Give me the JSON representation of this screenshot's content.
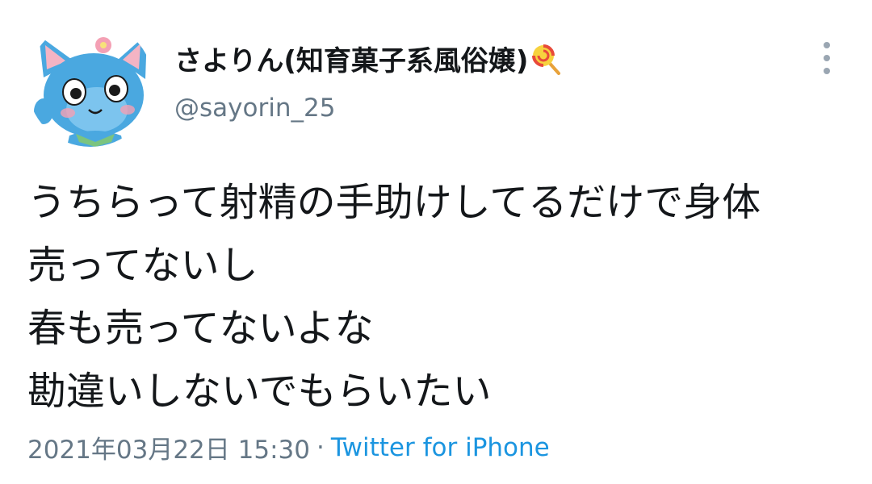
{
  "user": {
    "display_name": "さよりん(知育菓子系風俗嬢)",
    "handle": "@sayorin_25",
    "name_emoji": "lollipop-icon",
    "avatar": "happy-cat-avatar"
  },
  "tweet": {
    "lines": [
      "うちらって射精の手助けしてるだけで身体",
      "売ってないし",
      "春も売ってないよな",
      "勘違いしないでもらいたい"
    ]
  },
  "meta": {
    "timestamp": "2021年03月22日 15:30",
    "separator": "·",
    "source": "Twitter for iPhone"
  },
  "colors": {
    "text": "#14171a",
    "secondary": "#657786",
    "link": "#1b95e0",
    "avatar_blue": "#4aa8e0"
  },
  "icons": {
    "more": "more-options-icon"
  }
}
